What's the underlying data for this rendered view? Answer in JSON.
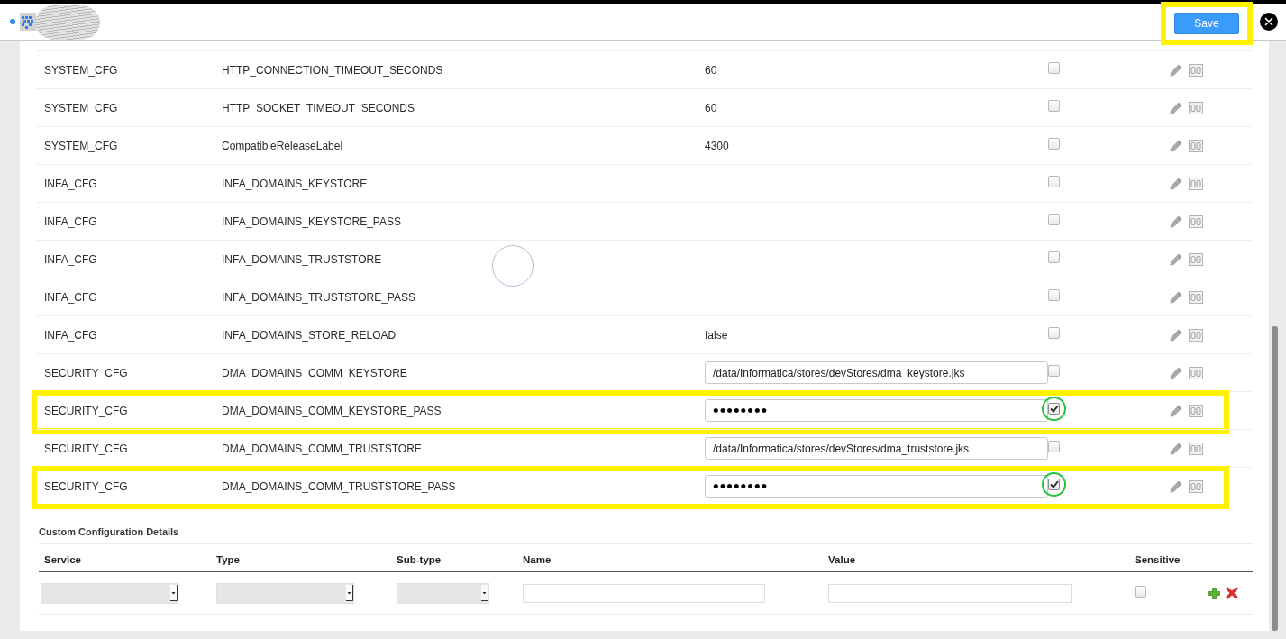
{
  "header": {
    "save_button": {
      "label": "Save",
      "highlighted": true
    }
  },
  "config_table": {
    "rows": [
      {
        "column_1": "SYSTEM_CFG",
        "column_2": "HTTP_CONNECTION_TIMEOUT_SECONDS",
        "column_3": "60",
        "kind": "text",
        "checked": false,
        "highlighted": false,
        "circled": false
      },
      {
        "column_1": "SYSTEM_CFG",
        "column_2": "HTTP_SOCKET_TIMEOUT_SECONDS",
        "column_3": "60",
        "kind": "text",
        "checked": false,
        "highlighted": false,
        "circled": false
      },
      {
        "column_1": "SYSTEM_CFG",
        "column_2": "CompatibleReleaseLabel",
        "column_3": "4300",
        "kind": "text",
        "checked": false,
        "highlighted": false,
        "circled": false
      },
      {
        "column_1": "INFA_CFG",
        "column_2": "INFA_DOMAINS_KEYSTORE",
        "kind": "text",
        "checked": false,
        "highlighted": false,
        "circled": false
      },
      {
        "column_1": "INFA_CFG",
        "column_2": "INFA_DOMAINS_KEYSTORE_PASS",
        "kind": "text",
        "checked": false,
        "highlighted": false,
        "circled": false
      },
      {
        "column_1": "INFA_CFG",
        "column_2": "INFA_DOMAINS_TRUSTSTORE",
        "kind": "text",
        "checked": false,
        "highlighted": false,
        "circled": false
      },
      {
        "column_1": "INFA_CFG",
        "column_2": "INFA_DOMAINS_TRUSTSTORE_PASS",
        "kind": "text",
        "checked": false,
        "highlighted": false,
        "circled": false
      },
      {
        "column_1": "INFA_CFG",
        "column_2": "INFA_DOMAINS_STORE_RELOAD",
        "column_3": "false",
        "kind": "text",
        "checked": false,
        "highlighted": false,
        "circled": false
      },
      {
        "column_1": "SECURITY_CFG",
        "column_2": "DMA_DOMAINS_COMM_KEYSTORE",
        "column_3": "/data/Informatica/stores/devStores/dma_keystore.jks",
        "kind": "input",
        "checked": false,
        "highlighted": false,
        "circled": false
      },
      {
        "column_1": "SECURITY_CFG",
        "column_2": "DMA_DOMAINS_COMM_KEYSTORE_PASS",
        "column_3": "••••••••",
        "kind": "masked",
        "checked": true,
        "highlighted": true,
        "circled": true
      },
      {
        "column_1": "SECURITY_CFG",
        "column_2": "DMA_DOMAINS_COMM_TRUSTSTORE",
        "column_3": "/data/Informatica/stores/devStores/dma_truststore.jks",
        "kind": "input",
        "checked": false,
        "highlighted": false,
        "circled": false
      },
      {
        "column_1": "SECURITY_CFG",
        "column_2": "DMA_DOMAINS_COMM_TRUSTSTORE_PASS",
        "column_3": "••••••••",
        "kind": "masked",
        "checked": true,
        "highlighted": true,
        "circled": true
      }
    ]
  },
  "custom_config": {
    "title": "Custom Configuration Details",
    "columns": [
      {
        "label": "Service",
        "kind": "dropdown"
      },
      {
        "label": "Type",
        "kind": "dropdown"
      },
      {
        "label": "Sub-type",
        "kind": "dropdown"
      },
      {
        "label": "Name",
        "kind": "input"
      },
      {
        "label": "Value",
        "kind": "input"
      },
      {
        "label": "Sensitive",
        "kind": "checkbox"
      }
    ],
    "new_row": {
      "checked": false
    }
  }
}
